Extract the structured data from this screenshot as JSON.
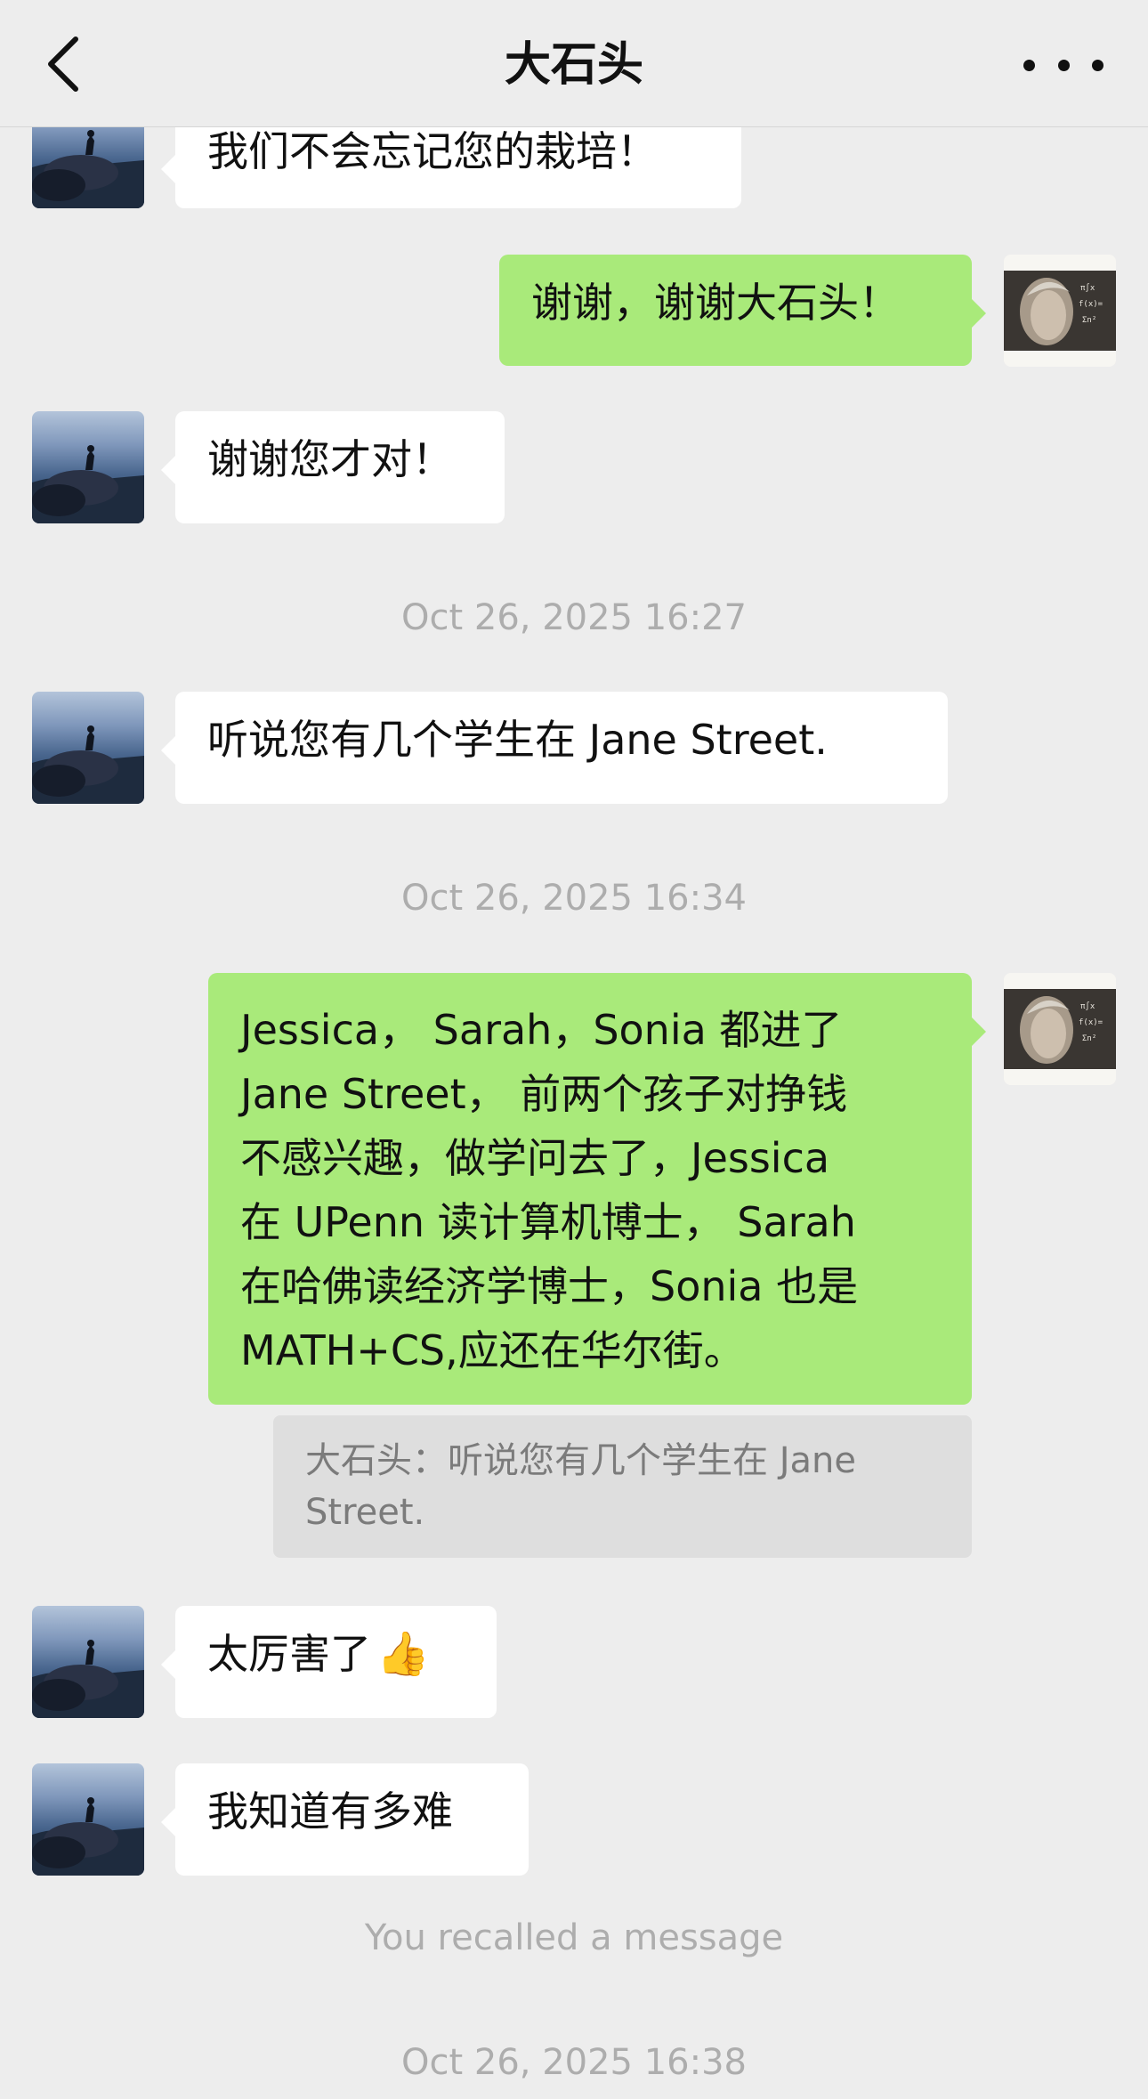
{
  "header": {
    "title": "大石头",
    "back_icon": "chevron-left-icon",
    "more_icon": "more-dots-icon"
  },
  "messages": [
    {
      "id": "m1",
      "sender": "contact",
      "text": "我们不会忘记您的栽培！"
    },
    {
      "id": "m2",
      "sender": "self",
      "text": "谢谢，谢谢大石头！"
    },
    {
      "id": "m3",
      "sender": "contact",
      "text": "谢谢您才对！"
    },
    {
      "id": "m4",
      "sender": "contact",
      "text": "听说您有几个学生在 Jane Street."
    },
    {
      "id": "m5",
      "sender": "self",
      "lines": [
        "Jessica，  Sarah，Sonia 都进了",
        "Jane Street，  前两个孩子对挣钱",
        "不感兴趣，做学问去了，Jessica",
        "在 UPenn 读计算机博士，  Sarah",
        "在哈佛读经济学博士，Sonia 也是",
        "MATH+CS,应还在华尔街。"
      ]
    },
    {
      "id": "m6",
      "sender": "contact",
      "text": "太厉害了",
      "emoji": "👍"
    },
    {
      "id": "m7",
      "sender": "contact",
      "text": "我知道有多难"
    }
  ],
  "quote": {
    "lines": [
      "大石头：听说您有几个学生在 Jane",
      "Street."
    ]
  },
  "timestamps": {
    "t1": "Oct 26, 2025 16:27",
    "t2": "Oct 26, 2025 16:34",
    "t3": "Oct 26, 2025 16:38"
  },
  "system_notice": "You recalled a message",
  "colors": {
    "background": "#ededed",
    "outgoing_bubble": "#a9ea7a",
    "incoming_bubble": "#ffffff",
    "meta_text": "#adadad"
  }
}
